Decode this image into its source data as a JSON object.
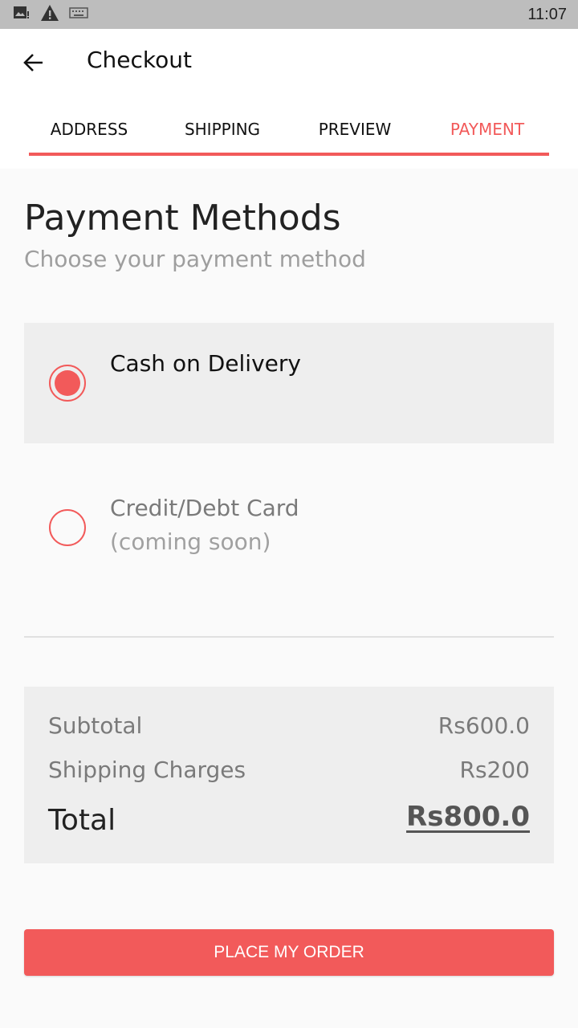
{
  "status_bar": {
    "time": "11:07",
    "icons": [
      "image-notification-icon",
      "warning-icon",
      "keyboard-icon"
    ]
  },
  "header": {
    "title": "Checkout",
    "back_icon": "arrow-back-icon"
  },
  "tabs": [
    {
      "label": "ADDRESS",
      "active": false
    },
    {
      "label": "SHIPPING",
      "active": false
    },
    {
      "label": "PREVIEW",
      "active": false
    },
    {
      "label": "PAYMENT",
      "active": true
    }
  ],
  "payment": {
    "title": "Payment Methods",
    "subtitle": "Choose your payment method",
    "options": [
      {
        "label": "Cash on Delivery",
        "sublabel": "",
        "selected": true
      },
      {
        "label": "Credit/Debt Card",
        "sublabel": "(coming soon)",
        "selected": false
      }
    ]
  },
  "summary": {
    "subtotal_label": "Subtotal",
    "subtotal_value": "Rs600.0",
    "shipping_label": "Shipping Charges",
    "shipping_value": "Rs200",
    "total_label": "Total",
    "total_value": "Rs800.0"
  },
  "actions": {
    "place_order_label": "PLACE MY ORDER"
  },
  "colors": {
    "accent": "#f25a5a",
    "status_bar": "#bdbdbd",
    "background": "#fafafa",
    "card_background": "#eeeeee"
  }
}
